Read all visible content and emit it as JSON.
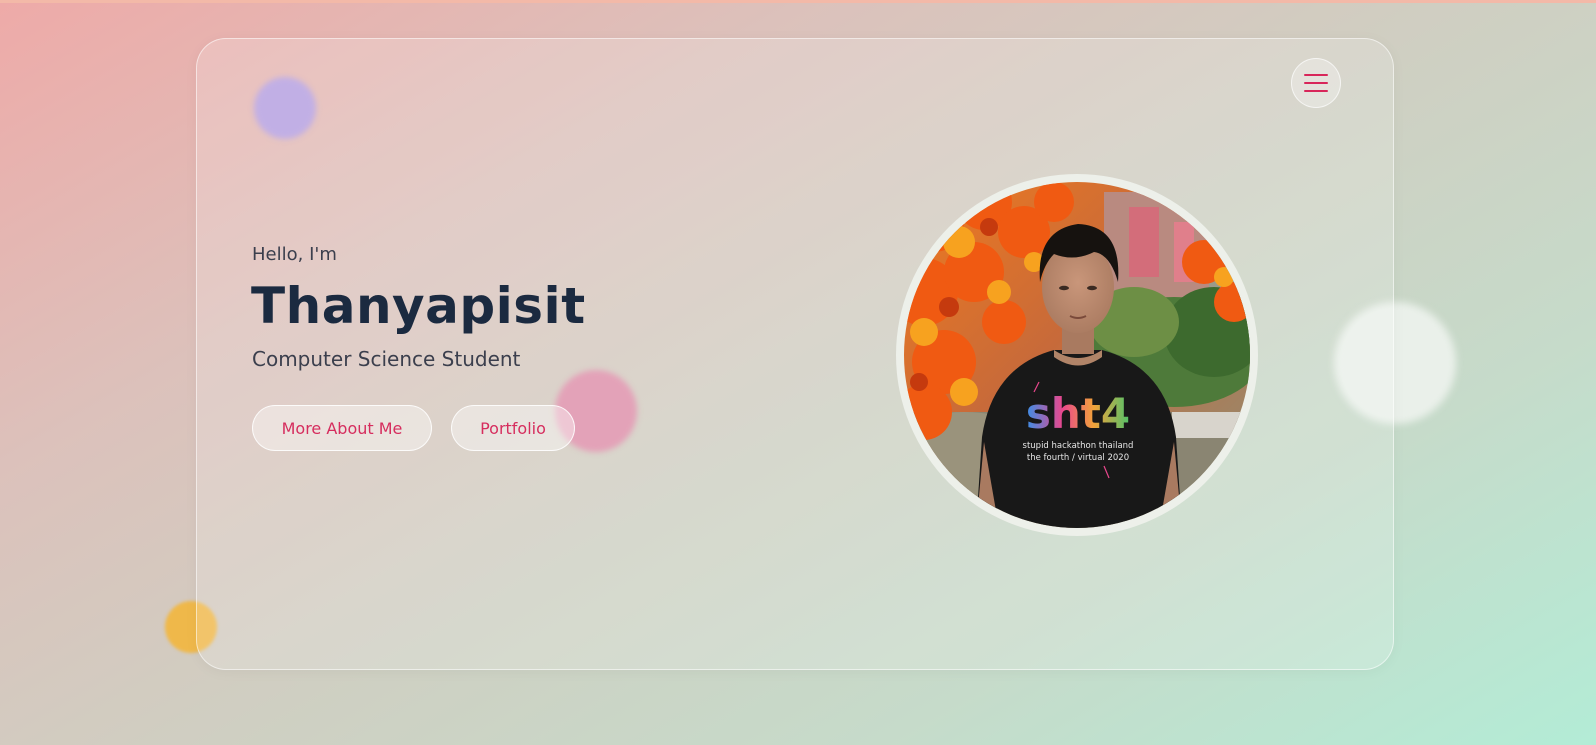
{
  "hero": {
    "greeting": "Hello, I'm",
    "name": "Thanyapisit",
    "role": "Computer Science Student"
  },
  "buttons": {
    "about_label": "More About Me",
    "portfolio_label": "Portfolio"
  },
  "menu": {
    "icon": "hamburger-menu-icon"
  },
  "profile_photo": {
    "shirt_text_main": "sht4",
    "shirt_text_line1": "stupid hackathon thailand",
    "shirt_text_line2": "the fourth / virtual 2020"
  },
  "colors": {
    "accent": "#d62d5e",
    "heading": "#1b2a40",
    "body_text": "#3b3f4d"
  }
}
